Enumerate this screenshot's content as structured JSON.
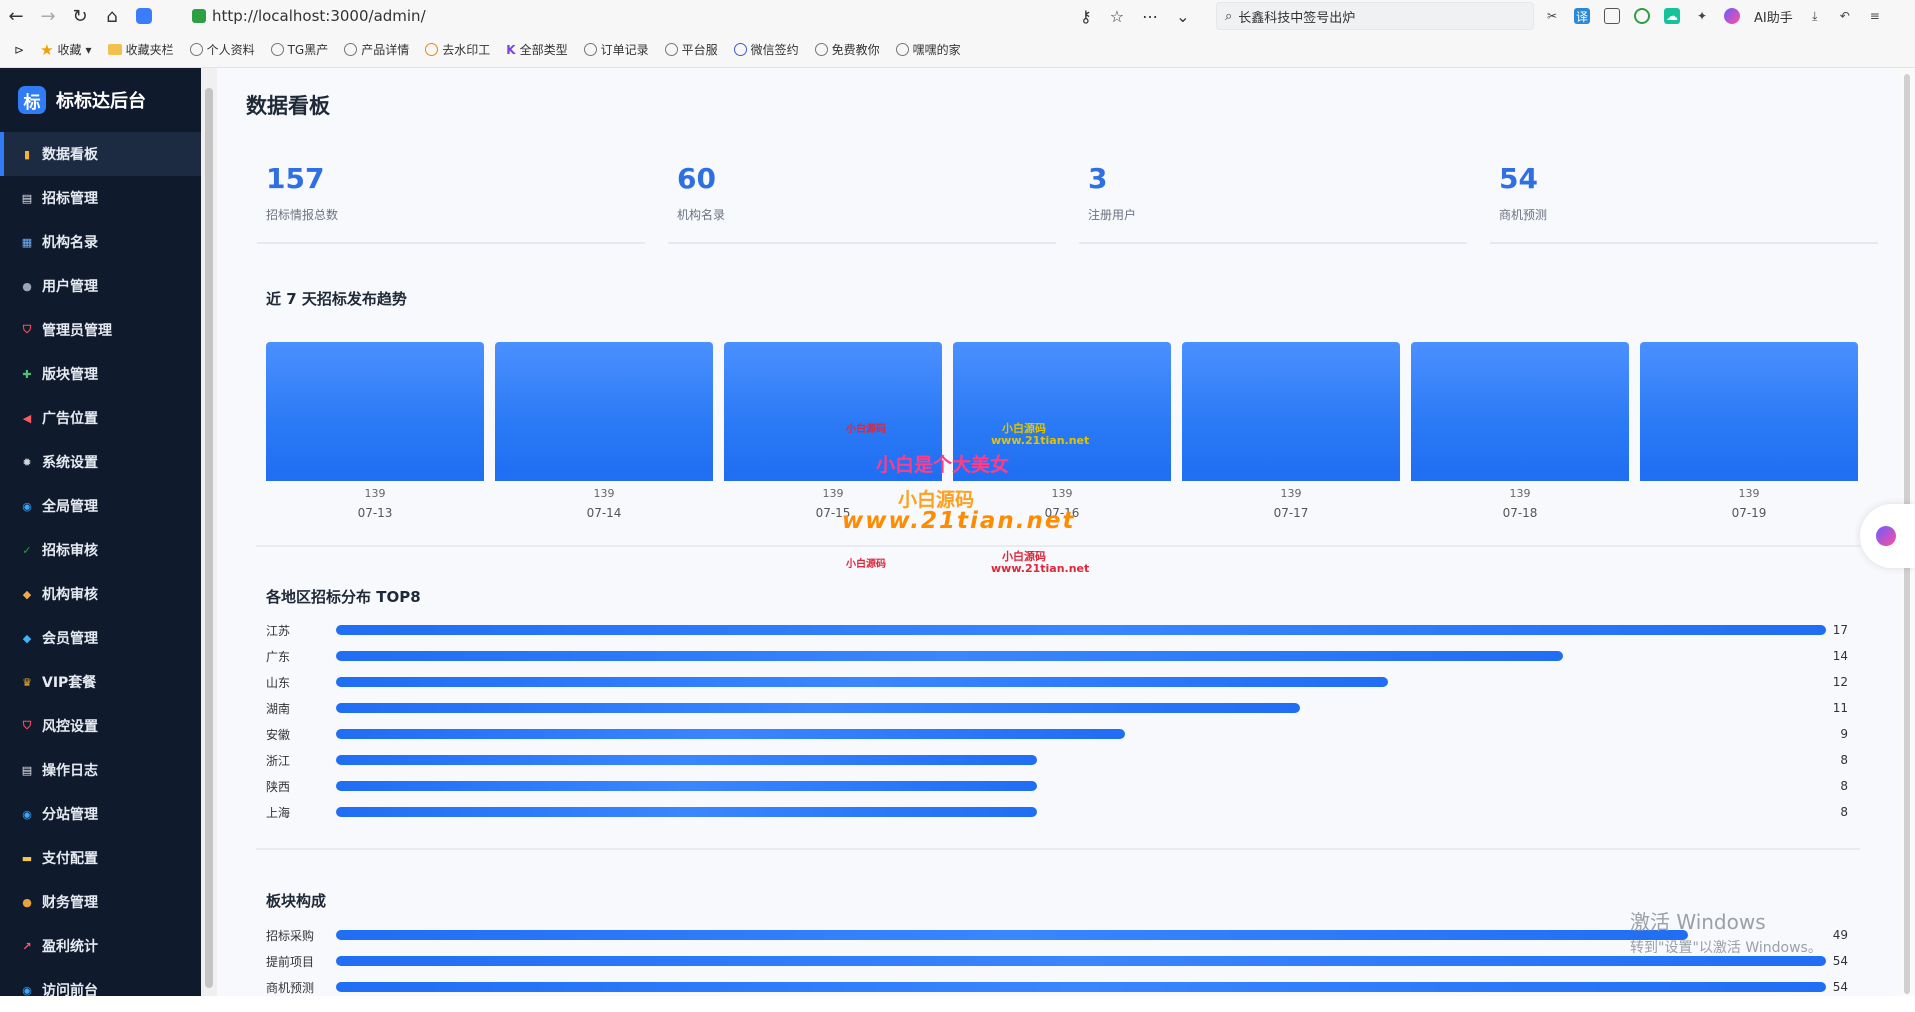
{
  "browser": {
    "url": "http://localhost:3000/admin/",
    "search_text": "长鑫科技中签号出炉",
    "ai_label": "AI助手",
    "bookmarks": [
      "收藏",
      "收藏夹栏",
      "个人资料",
      "TG黑产",
      "产品详情",
      "去水印工",
      "全部类型",
      "订单记录",
      "平台服",
      "微信签约",
      "免费教你",
      "嘿嘿的家"
    ]
  },
  "sidebar": {
    "brand_logo": "标",
    "brand_title": "标标达后台",
    "items": [
      {
        "label": "数据看板",
        "icon": "chart-icon",
        "active": true
      },
      {
        "label": "招标管理",
        "icon": "document-icon"
      },
      {
        "label": "机构名录",
        "icon": "grid-icon"
      },
      {
        "label": "用户管理",
        "icon": "user-icon"
      },
      {
        "label": "管理员管理",
        "icon": "shield-icon"
      },
      {
        "label": "版块管理",
        "icon": "puzzle-icon"
      },
      {
        "label": "广告位置",
        "icon": "megaphone-icon"
      },
      {
        "label": "系统设置",
        "icon": "gear-icon"
      },
      {
        "label": "全局管理",
        "icon": "globe-icon"
      },
      {
        "label": "招标审核",
        "icon": "check-icon"
      },
      {
        "label": "机构审核",
        "icon": "tag-icon"
      },
      {
        "label": "会员管理",
        "icon": "diamond-icon"
      },
      {
        "label": "VIP套餐",
        "icon": "crown-icon"
      },
      {
        "label": "风控设置",
        "icon": "shield-icon"
      },
      {
        "label": "操作日志",
        "icon": "document-icon"
      },
      {
        "label": "分站管理",
        "icon": "globe-icon"
      },
      {
        "label": "支付配置",
        "icon": "card-icon"
      },
      {
        "label": "财务管理",
        "icon": "moneybag-icon"
      },
      {
        "label": "盈利统计",
        "icon": "chart-up-icon"
      },
      {
        "label": "访问前台",
        "icon": "globe-icon"
      }
    ]
  },
  "page": {
    "title": "数据看板",
    "stats": [
      {
        "value": "157",
        "label": "招标情报总数"
      },
      {
        "value": "60",
        "label": "机构名录"
      },
      {
        "value": "3",
        "label": "注册用户"
      },
      {
        "value": "54",
        "label": "商机预测"
      }
    ],
    "trend_title": "近 7 天招标发布趋势",
    "region_title": "各地区招标分布 TOP8",
    "block_title": "板块构成"
  },
  "chart_data": [
    {
      "type": "bar",
      "title": "近 7 天招标发布趋势",
      "categories": [
        "07-13",
        "07-14",
        "07-15",
        "07-16",
        "07-17",
        "07-18",
        "07-19"
      ],
      "values": [
        139,
        139,
        139,
        139,
        139,
        139,
        139
      ]
    },
    {
      "type": "bar",
      "orientation": "horizontal",
      "title": "各地区招标分布 TOP8",
      "categories": [
        "江苏",
        "广东",
        "山东",
        "湖南",
        "安徽",
        "浙江",
        "陕西",
        "上海"
      ],
      "values": [
        17,
        14,
        12,
        11,
        9,
        8,
        8,
        8
      ]
    },
    {
      "type": "bar",
      "orientation": "horizontal",
      "title": "板块构成",
      "categories": [
        "招标采购",
        "提前项目",
        "商机预测"
      ],
      "values": [
        49,
        54,
        54
      ]
    }
  ],
  "watermark": {
    "line1": "小白源码",
    "line2": "www.21tian.net",
    "line3": "小白是个大美女",
    "line4": "小白源码",
    "line5": "www.21tian.net"
  },
  "windows_watermark": {
    "line1": "激活 Windows",
    "line2": "转到\"设置\"以激活 Windows。"
  },
  "colors": {
    "accent": "#2f7cf6",
    "sidebar_bg": "#0f1a2c",
    "stat_value": "#2f6fe4",
    "bar_fill": "#2a79f5"
  }
}
